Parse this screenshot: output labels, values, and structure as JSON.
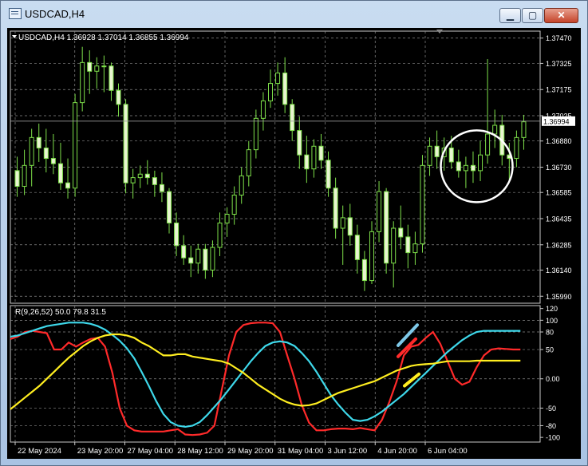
{
  "window": {
    "title": "USDCAD,H4"
  },
  "controls": {
    "minimize": "▁",
    "maximize": "▢",
    "close": "✕"
  },
  "header": {
    "info": "USDCAD,H4  1.36928 1.37014 1.36855 1.36994",
    "indicator": "R(9,26,52) 50.0 79.8 31.5"
  },
  "chart_data": [
    {
      "type": "candlestick",
      "title": "USDCAD,H4",
      "price_labels": [
        "1.37470",
        "1.37325",
        "1.37175",
        "1.37025",
        "1.36880",
        "1.36730",
        "1.36585",
        "1.36435",
        "1.36285",
        "1.36140",
        "1.35990"
      ],
      "price_values": [
        1.3747,
        1.37325,
        1.37175,
        1.37025,
        1.3688,
        1.3673,
        1.36585,
        1.36435,
        1.36285,
        1.3614,
        1.3599
      ],
      "ylim": [
        1.3595,
        1.3751
      ],
      "current_price": "1.36994",
      "current_value": 1.36994,
      "time_labels": [
        "22 May 2024",
        "23 May 20:00",
        "27 May 04:00",
        "28 May 12:00",
        "29 May 20:00",
        "31 May 04:00",
        "3 Jun 12:00",
        "4 Jun 20:00",
        "6 Jun 04:00"
      ],
      "colors": {
        "bull": "#e8f5d0",
        "bear": "#e8f5d0",
        "wick": "#7ee04a",
        "grid": "#8a8a8a",
        "circle": "#ffffff"
      },
      "ohlc": [
        [
          1.3671,
          1.3679,
          1.3656,
          1.3662
        ],
        [
          1.3662,
          1.3683,
          1.3657,
          1.3674
        ],
        [
          1.3674,
          1.3695,
          1.3662,
          1.369
        ],
        [
          1.369,
          1.3698,
          1.3676,
          1.3684
        ],
        [
          1.3684,
          1.3695,
          1.367,
          1.3678
        ],
        [
          1.3678,
          1.3692,
          1.3669,
          1.3675
        ],
        [
          1.3675,
          1.3687,
          1.366,
          1.3664
        ],
        [
          1.3664,
          1.3678,
          1.3655,
          1.3661
        ],
        [
          1.3661,
          1.3715,
          1.3656,
          1.371
        ],
        [
          1.371,
          1.3742,
          1.3705,
          1.3733
        ],
        [
          1.3733,
          1.374,
          1.3715,
          1.3728
        ],
        [
          1.3728,
          1.3736,
          1.3718,
          1.3731
        ],
        [
          1.3731,
          1.3737,
          1.3716,
          1.3731
        ],
        [
          1.3731,
          1.3733,
          1.3711,
          1.3717
        ],
        [
          1.3717,
          1.3721,
          1.3702,
          1.3709
        ],
        [
          1.3709,
          1.3712,
          1.3658,
          1.3664
        ],
        [
          1.3664,
          1.3672,
          1.3655,
          1.3667
        ],
        [
          1.3667,
          1.3674,
          1.3661,
          1.3669
        ],
        [
          1.3669,
          1.3677,
          1.3663,
          1.3667
        ],
        [
          1.3667,
          1.3671,
          1.3656,
          1.3663
        ],
        [
          1.3663,
          1.367,
          1.3653,
          1.3659
        ],
        [
          1.3659,
          1.3661,
          1.3635,
          1.3641
        ],
        [
          1.3641,
          1.3647,
          1.3622,
          1.3628
        ],
        [
          1.3628,
          1.3634,
          1.3617,
          1.3621
        ],
        [
          1.3621,
          1.3628,
          1.361,
          1.3618
        ],
        [
          1.3618,
          1.3629,
          1.3612,
          1.3626
        ],
        [
          1.3626,
          1.3629,
          1.3609,
          1.3614
        ],
        [
          1.3614,
          1.3631,
          1.361,
          1.3627
        ],
        [
          1.3627,
          1.3647,
          1.3622,
          1.3641
        ],
        [
          1.3641,
          1.365,
          1.3633,
          1.3646
        ],
        [
          1.3646,
          1.3662,
          1.364,
          1.3657
        ],
        [
          1.3657,
          1.3673,
          1.3652,
          1.3668
        ],
        [
          1.3668,
          1.3688,
          1.3662,
          1.3683
        ],
        [
          1.3683,
          1.3706,
          1.3678,
          1.3701
        ],
        [
          1.3701,
          1.3716,
          1.3694,
          1.3711
        ],
        [
          1.3711,
          1.3729,
          1.3707,
          1.3721
        ],
        [
          1.3721,
          1.3733,
          1.3714,
          1.3727
        ],
        [
          1.3727,
          1.3736,
          1.3704,
          1.3709
        ],
        [
          1.3709,
          1.3712,
          1.3688,
          1.3694
        ],
        [
          1.3694,
          1.3702,
          1.3672,
          1.368
        ],
        [
          1.368,
          1.3691,
          1.3664,
          1.3672
        ],
        [
          1.3672,
          1.3689,
          1.3667,
          1.3685
        ],
        [
          1.3685,
          1.3692,
          1.3672,
          1.3677
        ],
        [
          1.3677,
          1.3682,
          1.3656,
          1.3661
        ],
        [
          1.3661,
          1.3667,
          1.3632,
          1.3638
        ],
        [
          1.3638,
          1.3651,
          1.3617,
          1.3644
        ],
        [
          1.3644,
          1.3652,
          1.3628,
          1.3634
        ],
        [
          1.3634,
          1.364,
          1.3612,
          1.362
        ],
        [
          1.362,
          1.3625,
          1.3602,
          1.3608
        ],
        [
          1.3608,
          1.3642,
          1.3606,
          1.3636
        ],
        [
          1.3636,
          1.3665,
          1.363,
          1.3659
        ],
        [
          1.3659,
          1.3661,
          1.3612,
          1.3618
        ],
        [
          1.3618,
          1.3642,
          1.3604,
          1.3638
        ],
        [
          1.3638,
          1.3651,
          1.3626,
          1.3633
        ],
        [
          1.3633,
          1.364,
          1.3615,
          1.3624
        ],
        [
          1.3624,
          1.3636,
          1.3617,
          1.3629
        ],
        [
          1.3629,
          1.368,
          1.3624,
          1.3674
        ],
        [
          1.3674,
          1.369,
          1.3668,
          1.3685
        ],
        [
          1.3685,
          1.3694,
          1.3672,
          1.3679
        ],
        [
          1.3679,
          1.369,
          1.3671,
          1.3684
        ],
        [
          1.3684,
          1.3691,
          1.3672,
          1.3676
        ],
        [
          1.3676,
          1.3683,
          1.3667,
          1.3671
        ],
        [
          1.3671,
          1.3679,
          1.3661,
          1.3674
        ],
        [
          1.3674,
          1.3682,
          1.3664,
          1.3671
        ],
        [
          1.3671,
          1.3688,
          1.3665,
          1.368
        ],
        [
          1.368,
          1.3735,
          1.3675,
          1.3692
        ],
        [
          1.3692,
          1.3706,
          1.3684,
          1.3697
        ],
        [
          1.3697,
          1.3703,
          1.3674,
          1.368
        ],
        [
          1.368,
          1.3687,
          1.3665,
          1.3678
        ],
        [
          1.3678,
          1.3694,
          1.3673,
          1.369
        ],
        [
          1.369,
          1.3703,
          1.3683,
          1.3699
        ]
      ]
    },
    {
      "type": "line",
      "title": "R(9,26,52) 50.0 79.8 31.5",
      "ylabels": [
        "120",
        "100",
        "80",
        "50",
        "0.00",
        "-50",
        "-80",
        "-100"
      ],
      "ytick_values": [
        120,
        100,
        80,
        50,
        0,
        -50,
        -80,
        -100
      ],
      "ylim": [
        -108,
        125
      ],
      "series": [
        {
          "color": "#ff2a2a",
          "values": [
            68,
            72,
            80,
            82,
            80,
            78,
            50,
            50,
            62,
            55,
            62,
            68,
            70,
            55,
            10,
            -50,
            -80,
            -88,
            -90,
            -90,
            -90,
            -90,
            -88,
            -86,
            -95,
            -96,
            -95,
            -92,
            -80,
            -20,
            40,
            80,
            92,
            95,
            96,
            96,
            95,
            80,
            40,
            0,
            -45,
            -75,
            -88,
            -88,
            -86,
            -85,
            -85,
            -86,
            -84,
            -86,
            -88,
            -70,
            -40,
            -5,
            40,
            55,
            58,
            70,
            80,
            60,
            30,
            0,
            -10,
            -5,
            20,
            40,
            50,
            52,
            51,
            50,
            50
          ]
        },
        {
          "color": "#3ed8ea",
          "values": [
            72,
            74,
            78,
            82,
            86,
            90,
            92,
            94,
            96,
            96,
            96,
            94,
            90,
            84,
            75,
            65,
            52,
            35,
            12,
            -12,
            -38,
            -60,
            -74,
            -80,
            -82,
            -80,
            -74,
            -62,
            -48,
            -34,
            -18,
            -2,
            14,
            30,
            44,
            56,
            62,
            64,
            62,
            56,
            44,
            30,
            12,
            -8,
            -28,
            -44,
            -58,
            -70,
            -72,
            -70,
            -64,
            -56,
            -46,
            -36,
            -26,
            -14,
            -2,
            10,
            22,
            34,
            46,
            56,
            66,
            74,
            80,
            82,
            82,
            82,
            82,
            82,
            82
          ]
        },
        {
          "color": "#ffee20",
          "values": [
            -52,
            -42,
            -32,
            -22,
            -12,
            0,
            12,
            24,
            36,
            46,
            56,
            64,
            70,
            74,
            76,
            76,
            74,
            70,
            62,
            56,
            48,
            40,
            40,
            42,
            42,
            38,
            36,
            34,
            32,
            30,
            26,
            18,
            10,
            0,
            -10,
            -18,
            -26,
            -34,
            -40,
            -44,
            -46,
            -45,
            -42,
            -36,
            -30,
            -24,
            -20,
            -16,
            -12,
            -8,
            -4,
            2,
            8,
            14,
            18,
            22,
            24,
            25,
            26,
            28,
            30,
            30,
            30,
            30,
            31,
            31,
            31,
            31,
            31,
            31,
            31
          ]
        }
      ],
      "annotations": [
        "#7ec8e8",
        "#ff2a2a",
        "#ffee20"
      ]
    }
  ]
}
